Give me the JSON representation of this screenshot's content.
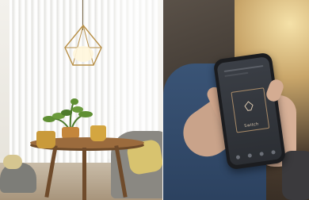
{
  "scene": {
    "left": {
      "description_colors": {
        "wood": "#9b6b3d",
        "mustard": "#d4a640",
        "plant": "#4d7a2c"
      }
    },
    "right": {
      "phone": {
        "app_button_label": "Switch",
        "app_icon": "lamp-icon"
      }
    }
  }
}
